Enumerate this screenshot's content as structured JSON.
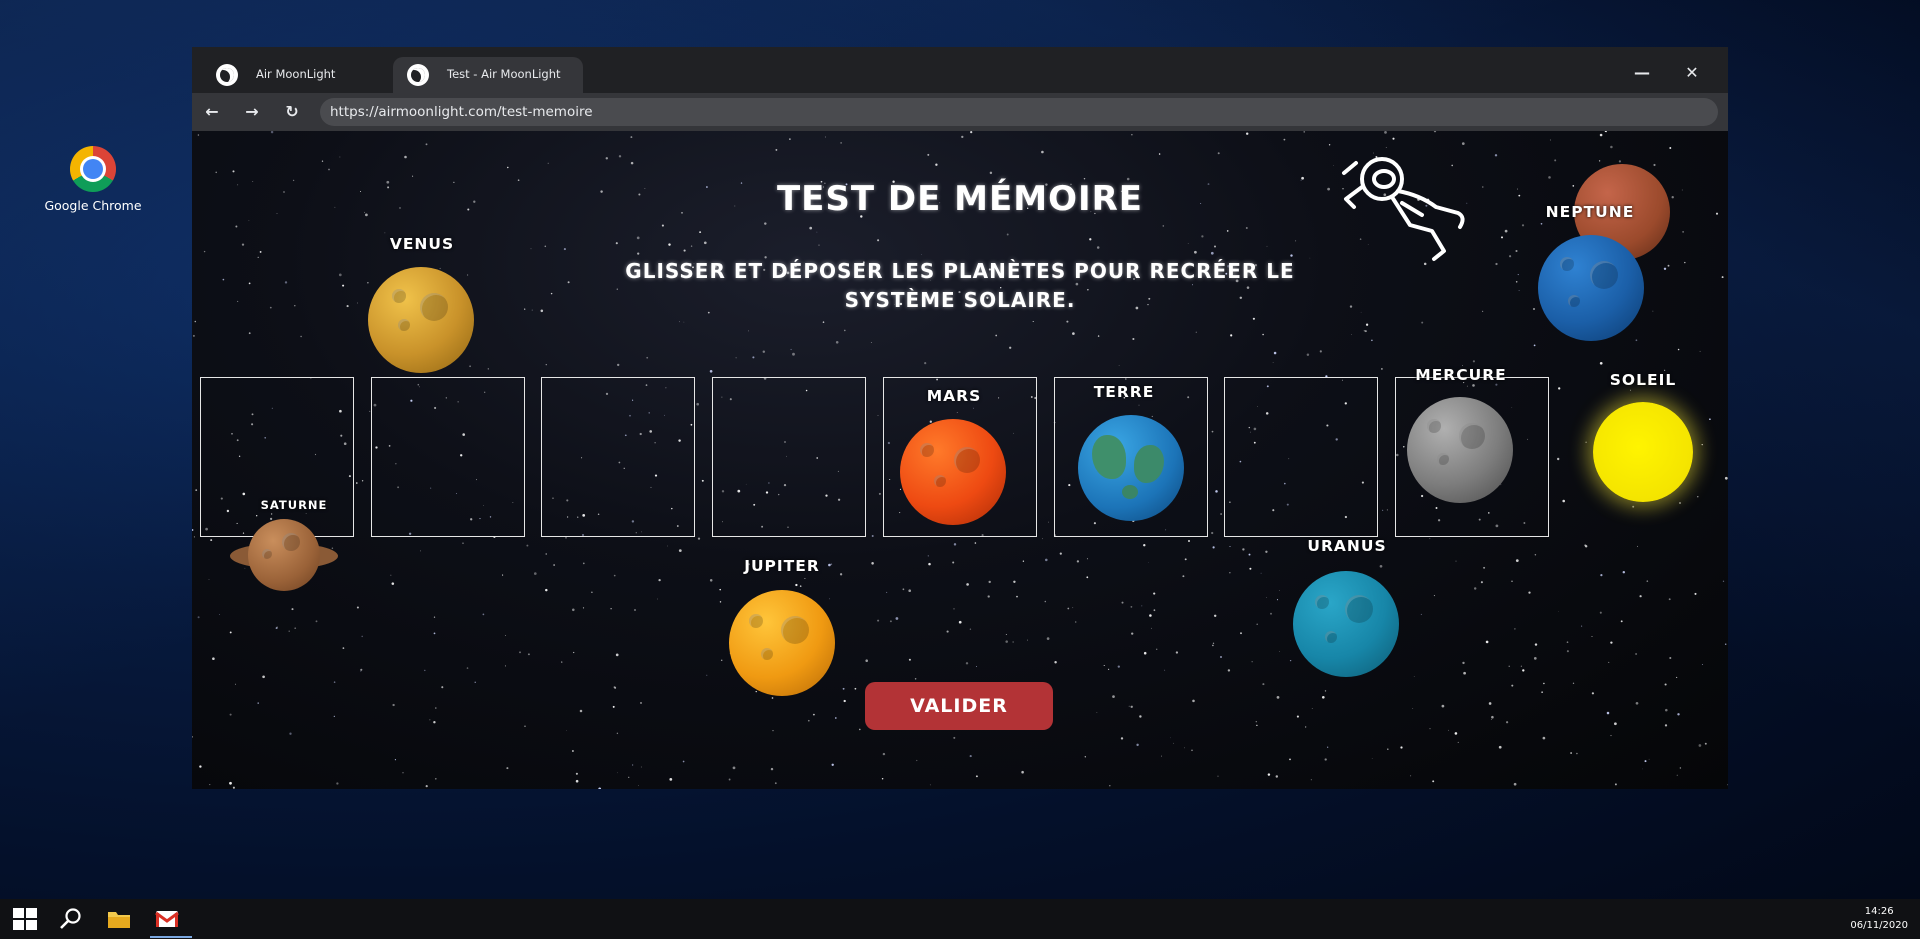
{
  "desktop": {
    "icon_label": "Google Chrome"
  },
  "browser": {
    "tabs": [
      {
        "label": "Air MoonLight",
        "active": false
      },
      {
        "label": "Test - Air MoonLight",
        "active": true
      }
    ],
    "url": "https://airmoonlight.com/test-memoire"
  },
  "page": {
    "title": "TEST DE MÉMOIRE",
    "subtitle": "GLISSER ET DÉPOSER LES PLANÈTES POUR RECRÉER LE SYSTÈME SOLAIRE.",
    "planets": {
      "venus": "VENUS",
      "saturne": "SATURNE",
      "jupiter": "JUPITER",
      "mars": "MARS",
      "terre": "TERRE",
      "uranus": "URANUS",
      "mercure": "MERCURE",
      "soleil": "SOLEIL",
      "neptune": "NEPTUNE"
    },
    "slot_count": 8,
    "submit_label": "VALIDER"
  },
  "taskbar": {
    "time": "14:26",
    "date": "06/11/2020"
  }
}
